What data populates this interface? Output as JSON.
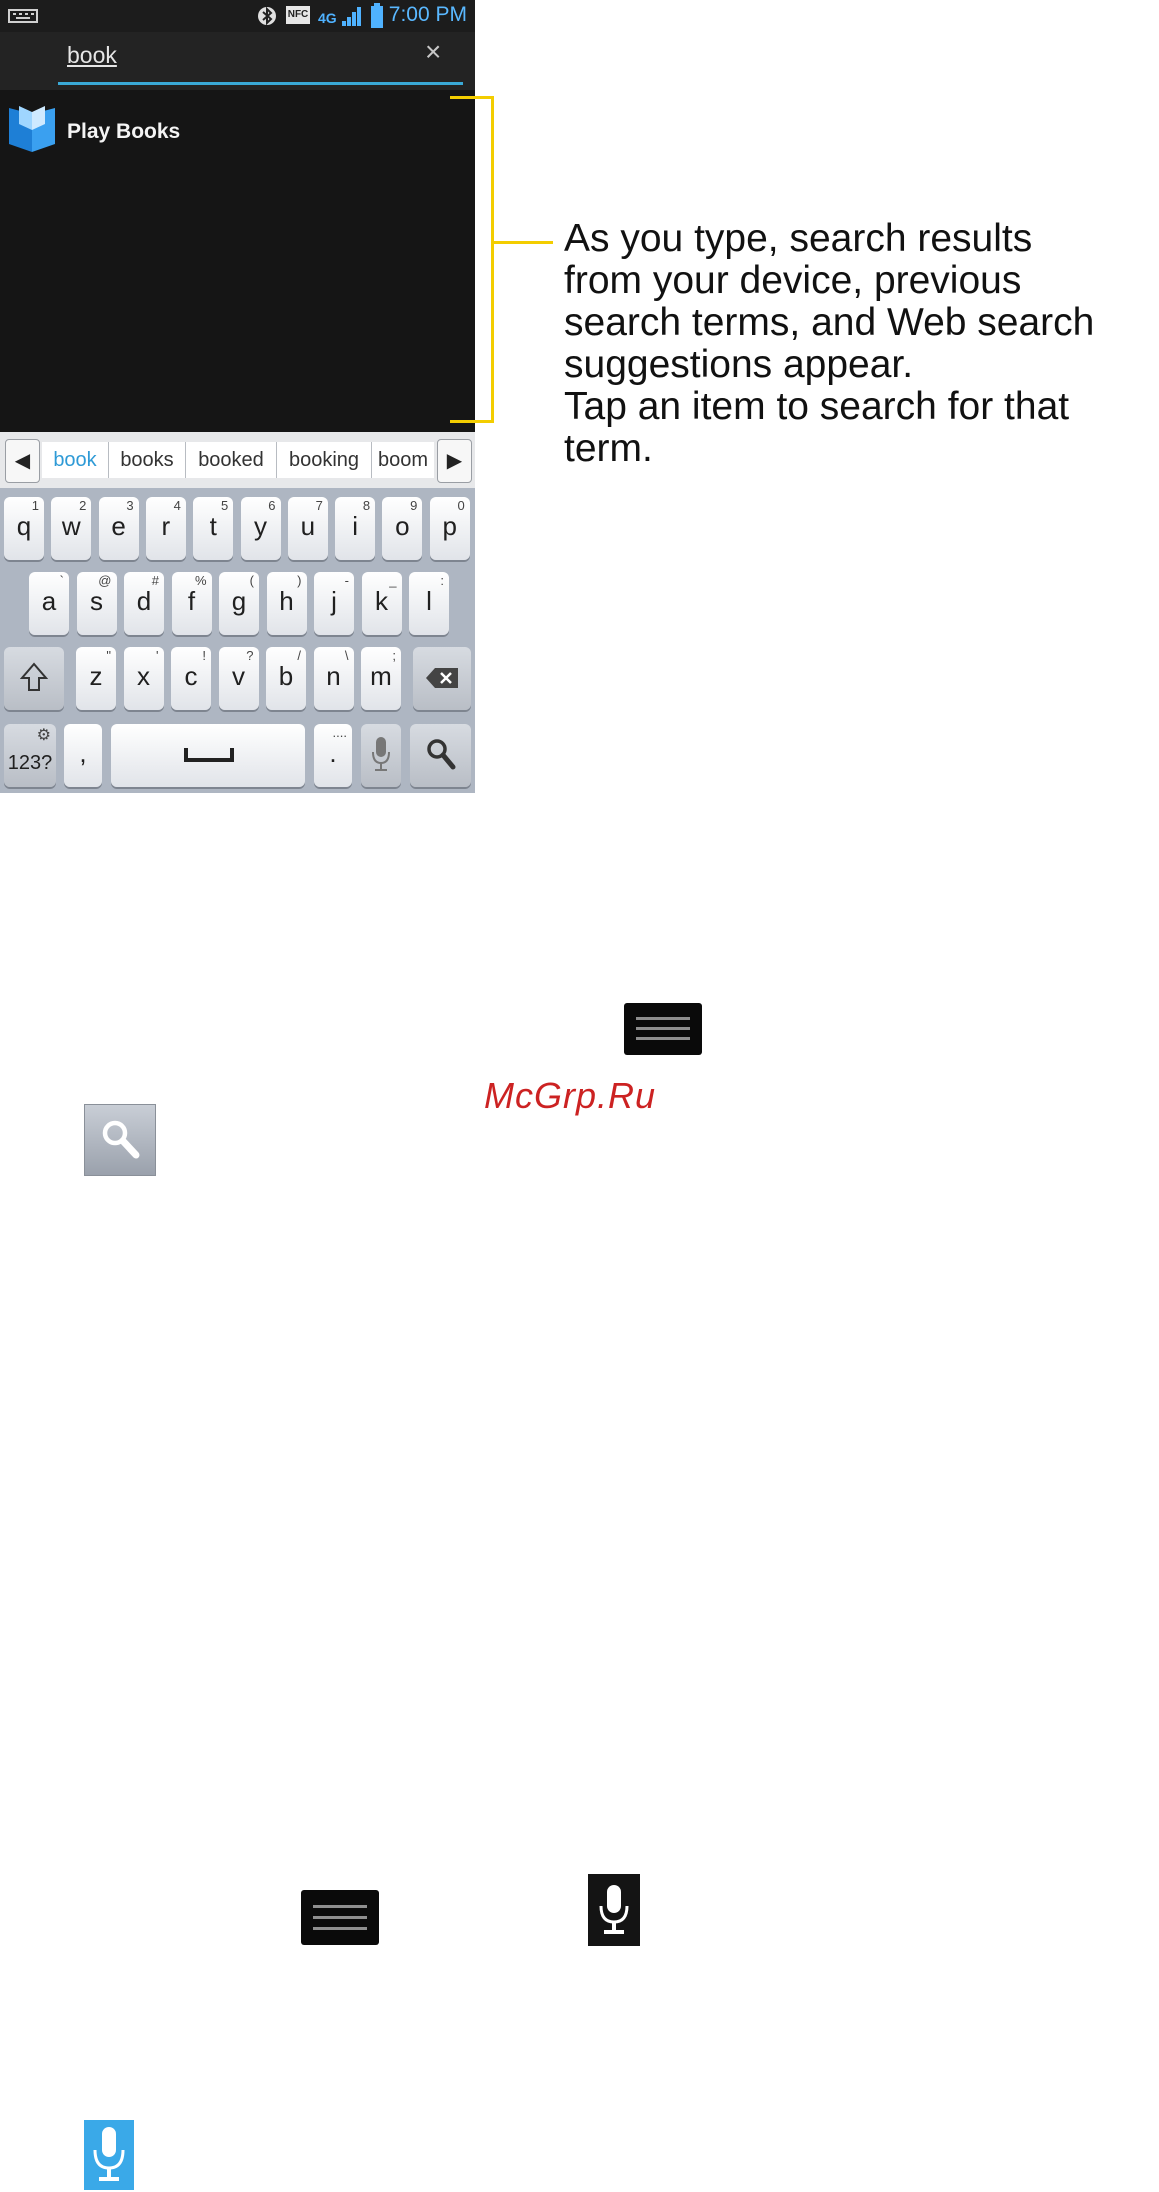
{
  "status_bar": {
    "time": "7:00 PM",
    "indicators": [
      "keyboard-icon",
      "bluetooth-icon",
      "nfc-icon",
      "4g-icon",
      "signal-icon",
      "battery-icon"
    ],
    "nfc_label": "NFC",
    "network_label": "4G"
  },
  "search": {
    "query": "book",
    "clear_icon": "close-icon"
  },
  "results": [
    {
      "label": "Play Books",
      "icon": "play-books-icon"
    }
  ],
  "suggestions": [
    "book",
    "books",
    "booked",
    "booking",
    "boom"
  ],
  "keyboard": {
    "row1": [
      [
        "q",
        "1"
      ],
      [
        "w",
        "2"
      ],
      [
        "e",
        "3"
      ],
      [
        "r",
        "4"
      ],
      [
        "t",
        "5"
      ],
      [
        "y",
        "6"
      ],
      [
        "u",
        "7"
      ],
      [
        "i",
        "8"
      ],
      [
        "o",
        "9"
      ],
      [
        "p",
        "0"
      ]
    ],
    "row2": [
      [
        "a",
        "`"
      ],
      [
        "s",
        "@"
      ],
      [
        "d",
        "#"
      ],
      [
        "f",
        "%"
      ],
      [
        "g",
        "("
      ],
      [
        "h",
        ")"
      ],
      [
        "j",
        "-"
      ],
      [
        "k",
        "_"
      ],
      [
        "l",
        ":"
      ]
    ],
    "row3": [
      [
        "z",
        "\""
      ],
      [
        "x",
        "'"
      ],
      [
        "c",
        "!"
      ],
      [
        "v",
        "?"
      ],
      [
        "b",
        "/"
      ],
      [
        "n",
        "\\"
      ],
      [
        "m",
        ";"
      ]
    ],
    "symbols_label": "123?",
    "comma": ",",
    "period": ".",
    "period_sub": "...."
  },
  "callout": {
    "lines": [
      "As you type, search results",
      "from your device, previous",
      "search terms, and Web search",
      "suggestions appear.",
      "Tap an item to search for that",
      "term."
    ],
    "accent_color": "#f3cd00"
  },
  "watermark": "McGrp.Ru",
  "page_icons": [
    "menu-icon",
    "search-icon",
    "menu-icon",
    "microphone-icon",
    "microphone-icon"
  ]
}
